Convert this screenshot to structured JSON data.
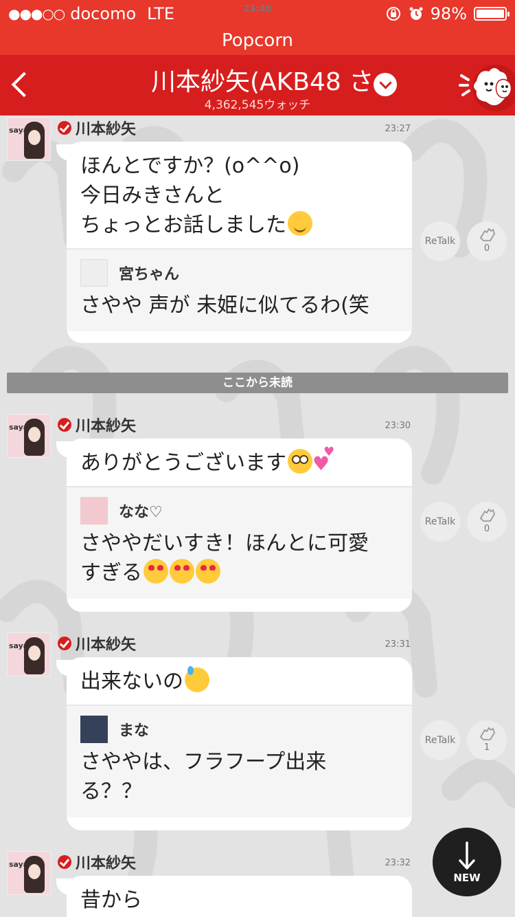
{
  "status_bar": {
    "carrier": "docomo",
    "network": "LTE",
    "time": "23:40",
    "battery": "98%"
  },
  "app": {
    "name": "Popcorn"
  },
  "header": {
    "title": "川本紗矢(AKB48 さ",
    "watch_count": "4,362,545ウォッチ",
    "back_icon": "chevron-left-icon",
    "dropdown_icon": "chevron-down-icon",
    "mascot_icon": "popcorn-mascot-icon"
  },
  "unread_divider": "ここから未読",
  "messages": [
    {
      "author": "川本紗矢",
      "avatar_tag": "saya",
      "time": "23:27",
      "text": "ほんとですか？(o^^o)\n今日みきさんと\nちょっとお話しました",
      "emoji": [
        "blush"
      ],
      "quote": {
        "name": "宮ちゃん",
        "text": "さやや 声が 未姫に似てるわ(笑"
      },
      "retalk": "ReTalk",
      "claps": "0"
    },
    {
      "author": "川本紗矢",
      "avatar_tag": "saya",
      "time": "23:30",
      "text": "ありがとうございます",
      "emoji": [
        "flushed",
        "two-hearts"
      ],
      "quote": {
        "name": "なな♡",
        "text": "さややだいすき！ほんとに可愛\nすぎる"
      },
      "retalk": "ReTalk",
      "claps": "0"
    },
    {
      "author": "川本紗矢",
      "avatar_tag": "saya",
      "time": "23:31",
      "text": "出来ないの",
      "emoji": [
        "downcast-sweat"
      ],
      "quote": {
        "name": "まな",
        "text": "さややは、フラフープ出来\nる？？"
      },
      "retalk": "ReTalk",
      "claps": "1"
    },
    {
      "author": "川本紗矢",
      "avatar_tag": "saya",
      "time": "23:32",
      "text": "昔から"
    }
  ],
  "new_button": {
    "label": "NEW",
    "icon": "arrow-down-icon"
  },
  "colors": {
    "accent": "#e8372b",
    "header": "#d71e1e",
    "background": "#e3e3e3"
  }
}
